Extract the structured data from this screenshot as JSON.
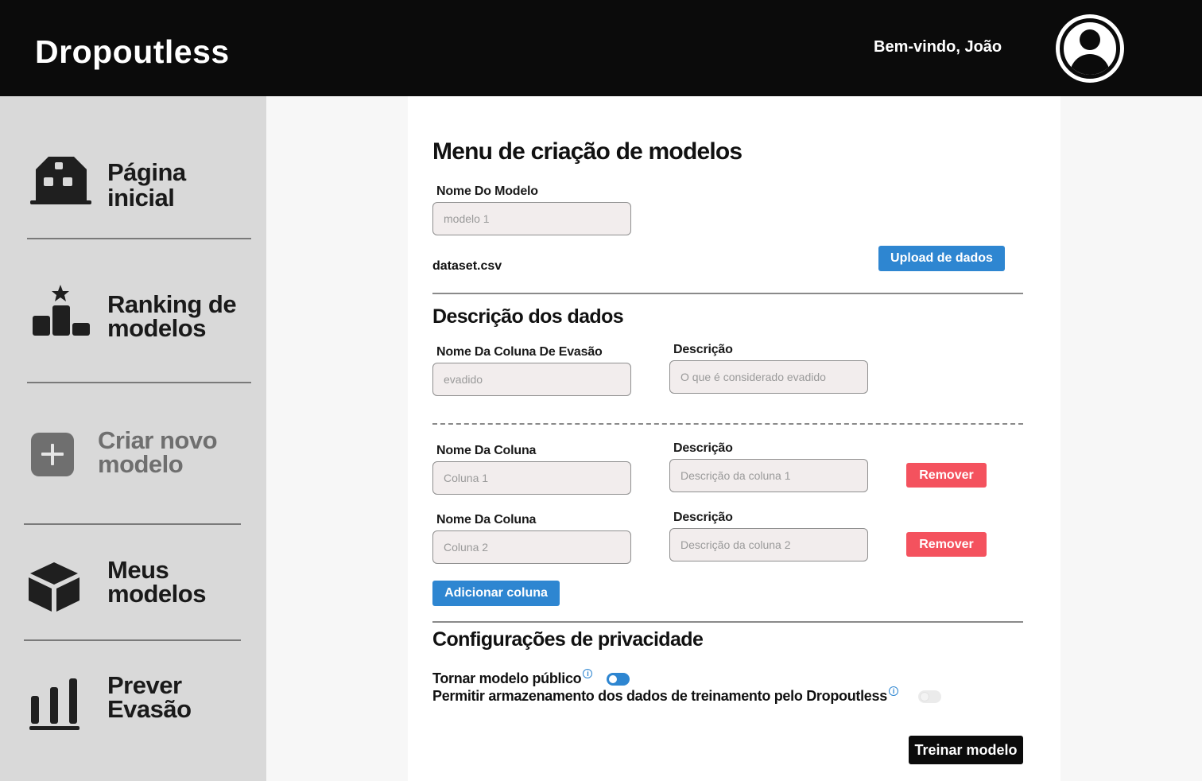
{
  "header": {
    "brand": "Dropoutless",
    "welcome": "Bem-vindo, João",
    "avatar_icon": "user-circle-icon"
  },
  "sidebar": {
    "items": [
      {
        "label_line1": "Página",
        "label_line2": "inicial",
        "icon": "home-icon",
        "state": "normal"
      },
      {
        "label_line1": "Ranking de",
        "label_line2": "modelos",
        "icon": "podium-icon",
        "state": "normal"
      },
      {
        "label_line1": "Criar novo",
        "label_line2": "modelo",
        "icon": "plus-square-icon",
        "state": "active-muted"
      },
      {
        "label_line1": "Meus",
        "label_line2": "modelos",
        "icon": "cube-icon",
        "state": "normal"
      },
      {
        "label_line1": "Prever",
        "label_line2": "Evasão",
        "icon": "bar-chart-icon",
        "state": "normal"
      }
    ]
  },
  "form": {
    "title": "Menu de criação de modelos",
    "model_name_label": "Nome Do Modelo",
    "model_name_placeholder": "modelo 1",
    "filename": "dataset.csv",
    "upload_label": "Upload de dados",
    "data_section_title": "Descrição dos dados",
    "dropout_col_label": "Nome Da Coluna De Evasão",
    "dropout_col_placeholder": "evadido",
    "dropout_desc_label": "Descrição",
    "dropout_desc_placeholder": "O que é considerado evadido",
    "columns": [
      {
        "name_label": "Nome Da Coluna",
        "name_placeholder": "Coluna 1",
        "desc_label": "Descrição",
        "desc_placeholder": "Descrição da coluna 1",
        "remove_label": "Remover"
      },
      {
        "name_label": "Nome Da Coluna",
        "name_placeholder": "Coluna 2",
        "desc_label": "Descrição",
        "desc_placeholder": "Descrição da coluna 2",
        "remove_label": "Remover"
      }
    ],
    "add_column_label": "Adicionar coluna",
    "privacy_title": "Configurações de privacidade",
    "public_label": "Tornar modelo público",
    "public_on": true,
    "store_label": "Permitir armazenamento dos dados de treinamento pelo Dropoutless",
    "store_on": false,
    "train_label": "Treinar modelo"
  },
  "colors": {
    "header_bg": "#0b0b0b",
    "sidebar_bg": "#d9d9d9",
    "accent_blue": "#2e86d1",
    "danger_red": "#f4525e"
  }
}
